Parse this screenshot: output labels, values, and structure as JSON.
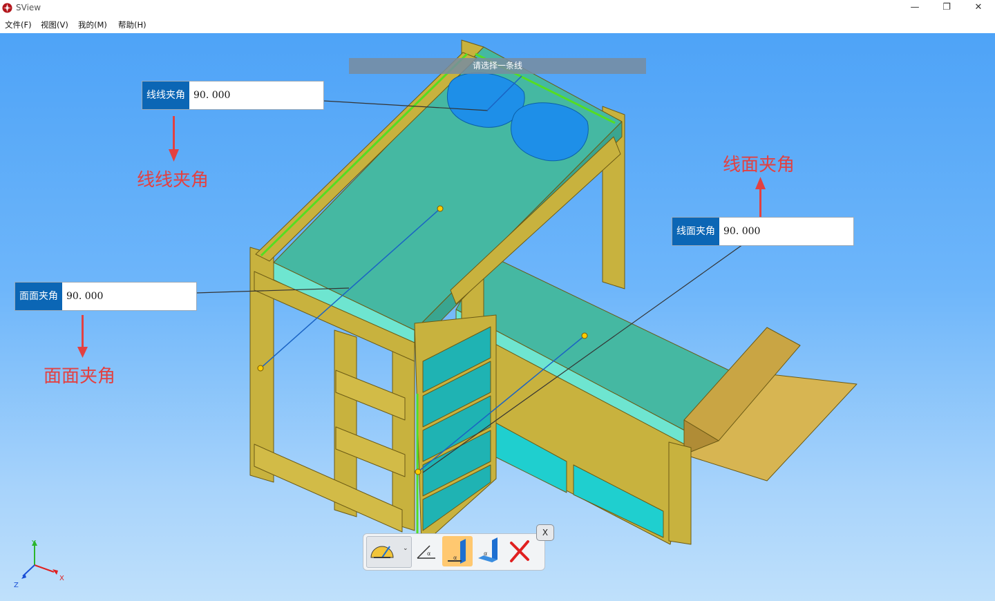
{
  "window": {
    "title": "SView",
    "minimize_icon": "minimize-icon",
    "restore_icon": "restore-icon",
    "close_icon": "close-icon"
  },
  "menu": {
    "items": [
      {
        "label": "文件(F)"
      },
      {
        "label": "视图(V)"
      },
      {
        "label": "我的(M)"
      },
      {
        "label": "帮助(H)"
      }
    ]
  },
  "viewport": {
    "hint": "请选择一条线",
    "measurements": {
      "line_line": {
        "label": "线线夹角",
        "value": "90. 000"
      },
      "line_face": {
        "label": "线面夹角",
        "value": "90. 000"
      },
      "face_face": {
        "label": "面面夹角",
        "value": "90. 000"
      }
    },
    "callouts": {
      "line_line": "线线夹角",
      "line_face": "线面夹角",
      "face_face": "面面夹角"
    },
    "axis": {
      "x": "X",
      "y": "Y",
      "z": "Z"
    }
  },
  "toolbar": {
    "close_label": "X",
    "buttons": [
      {
        "icon": "protractor-icon",
        "active": false
      },
      {
        "icon": "line-line-angle-icon",
        "active": false
      },
      {
        "icon": "line-face-angle-icon",
        "active": true
      },
      {
        "icon": "face-face-angle-icon",
        "active": false
      },
      {
        "icon": "delete-icon",
        "active": false
      }
    ]
  },
  "colors": {
    "accent": "#0b66b5",
    "callout": "#e34040",
    "wood": "#c8b23e",
    "mattress": "#45b8a2",
    "pillow": "#1e8fe8"
  }
}
